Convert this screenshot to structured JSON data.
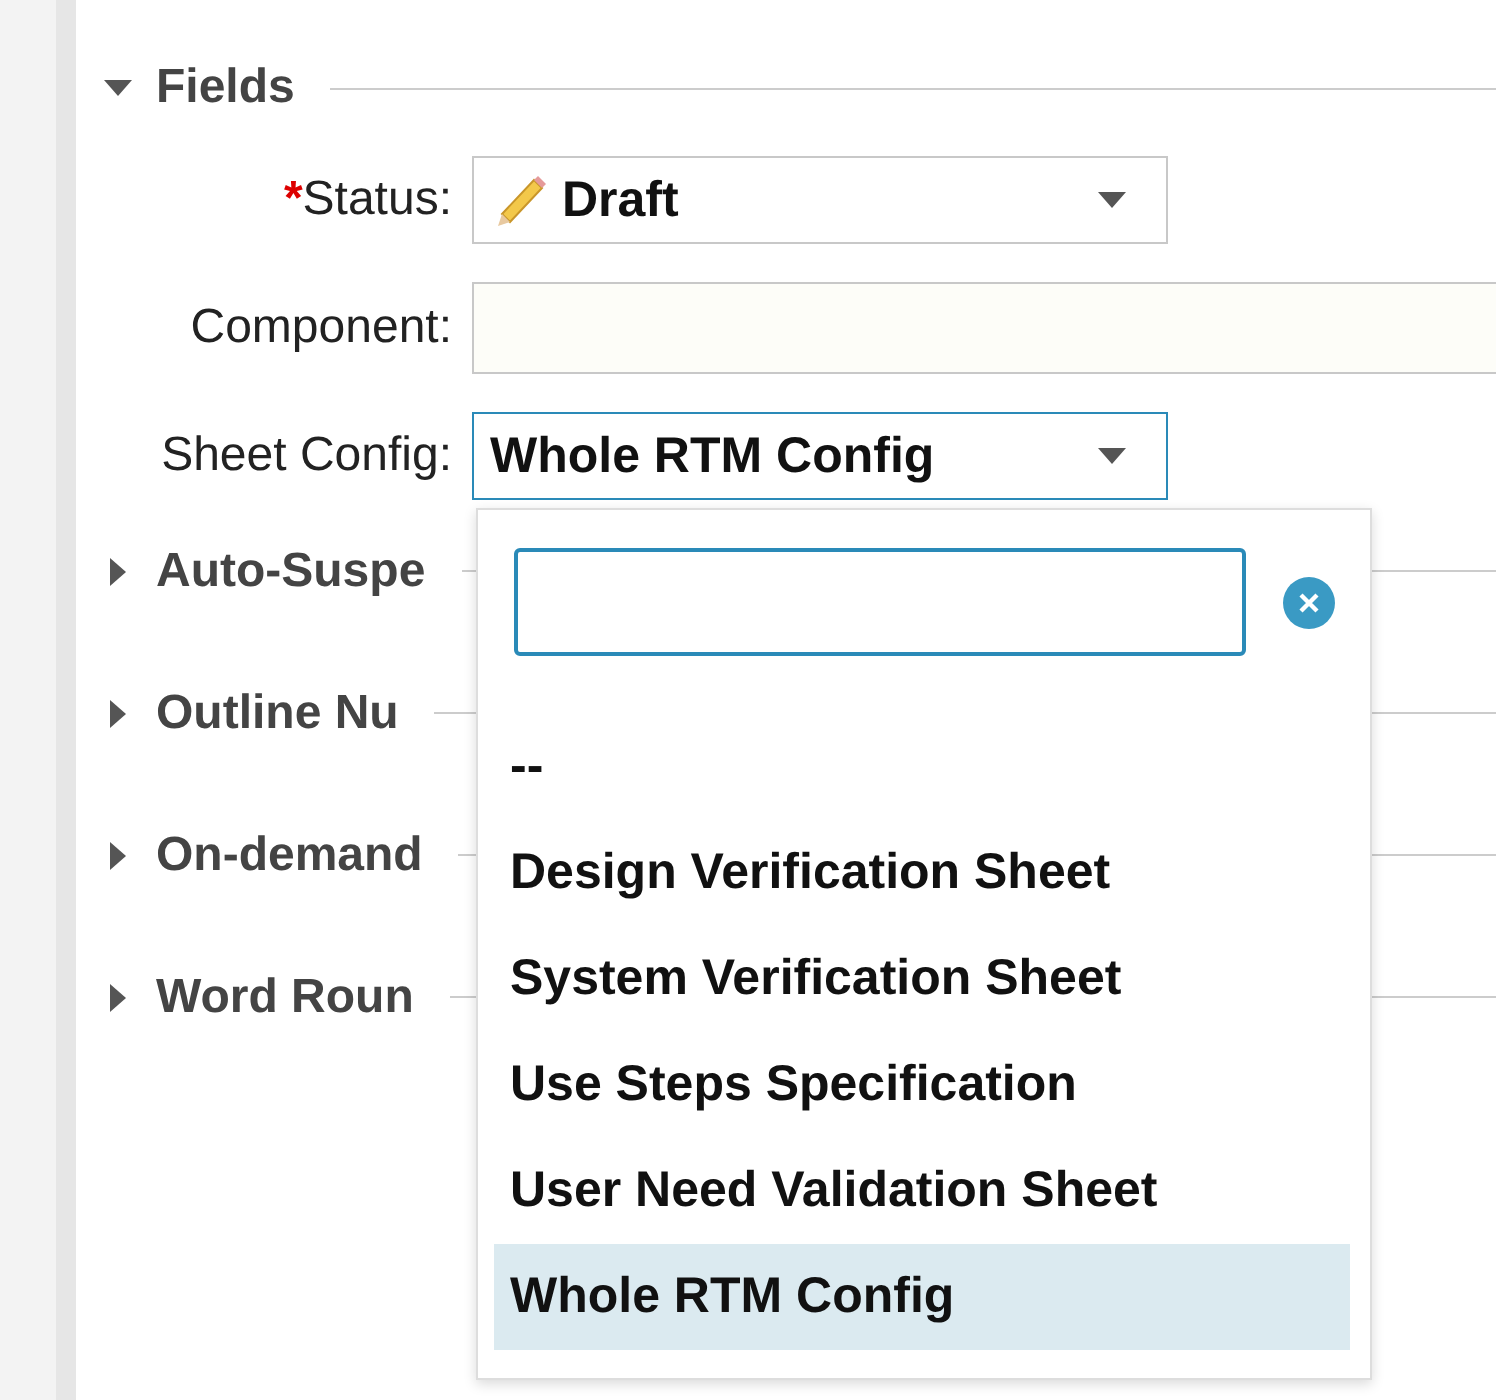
{
  "sections": [
    {
      "title": "Fields",
      "expanded": true,
      "fields": [
        {
          "label": "Status:",
          "required_mark": "*",
          "kind": "status",
          "value": "Draft"
        },
        {
          "label": "Component:",
          "kind": "text"
        },
        {
          "label": "Sheet Config:",
          "kind": "select",
          "value": "Whole RTM Config",
          "open": true,
          "options": [
            {
              "label": "--",
              "selected": false
            },
            {
              "label": "Design Verification Sheet",
              "selected": false
            },
            {
              "label": "System Verification Sheet",
              "selected": false
            },
            {
              "label": "Use Steps Specification",
              "selected": false
            },
            {
              "label": "User Need Validation Sheet",
              "selected": false
            },
            {
              "label": "Whole RTM Config",
              "selected": true
            }
          ]
        }
      ]
    },
    {
      "title": "Auto-Suspe",
      "expanded": false
    },
    {
      "title": "Outline Nu",
      "expanded": false
    },
    {
      "title": "On-demand",
      "expanded": false
    },
    {
      "title": "Word Roun",
      "expanded": false
    }
  ]
}
